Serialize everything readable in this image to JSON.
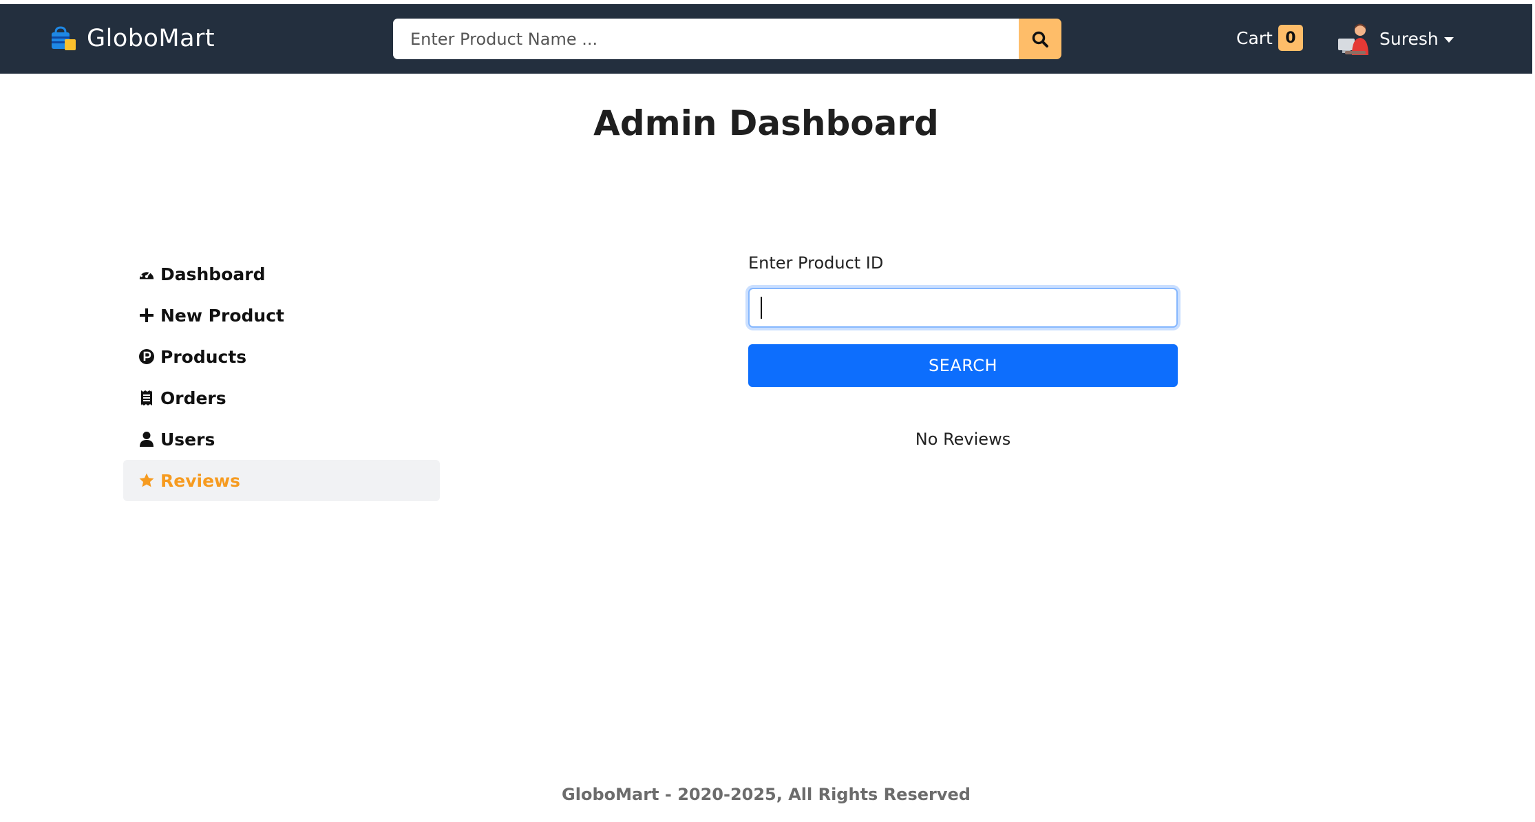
{
  "header": {
    "brand": "GloboMart",
    "search_placeholder": "Enter Product Name ...",
    "cart_label": "Cart",
    "cart_count": "0",
    "user_name": "Suresh"
  },
  "page": {
    "title": "Admin Dashboard"
  },
  "sidebar": {
    "items": [
      {
        "label": "Dashboard",
        "icon": "dashboard-gauge-icon",
        "active": false
      },
      {
        "label": "New Product",
        "icon": "plus-icon",
        "active": false
      },
      {
        "label": "Products",
        "icon": "product-p-icon",
        "active": false
      },
      {
        "label": "Orders",
        "icon": "receipt-icon",
        "active": false
      },
      {
        "label": "Users",
        "icon": "user-icon",
        "active": false
      },
      {
        "label": "Reviews",
        "icon": "star-icon",
        "active": true
      }
    ]
  },
  "review_search": {
    "label": "Enter Product ID",
    "input_value": "",
    "button_label": "SEARCH",
    "empty_message": "No Reviews"
  },
  "footer": {
    "text": "GloboMart - 2020-2025, All Rights Reserved"
  },
  "colors": {
    "navbar_bg": "#232f3e",
    "accent_orange": "#febd69",
    "active_text": "#f69b20",
    "primary_button": "#0d6efd"
  }
}
